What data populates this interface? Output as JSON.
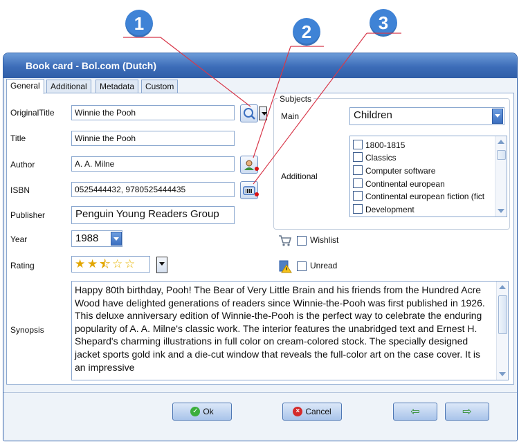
{
  "callouts": [
    "1",
    "2",
    "3"
  ],
  "window": {
    "title": "Book card - Bol.com (Dutch)"
  },
  "tabs": [
    "General",
    "Additional",
    "Metadata",
    "Custom fields"
  ],
  "fields": {
    "original_title": {
      "label": "OriginalTitle",
      "value": "Winnie the Pooh"
    },
    "title": {
      "label": "Title",
      "value": "Winnie the Pooh"
    },
    "author": {
      "label": "Author",
      "value": "A. A. Milne"
    },
    "isbn": {
      "label": "ISBN",
      "value": "0525444432, 9780525444435"
    },
    "publisher": {
      "label": "Publisher",
      "value": "Penguin Young Readers Group"
    },
    "year": {
      "label": "Year",
      "value": "1988"
    },
    "rating": {
      "label": "Rating",
      "value": 2.5,
      "max": 5
    },
    "synopsis": {
      "label": "Synopsis",
      "value": "Happy 80th birthday, Pooh! The Bear of Very Little Brain and his friends from the Hundred Acre Wood have delighted generations of readers since Winnie-the-Pooh was first published in 1926. This deluxe anniversary edition of Winnie-the-Pooh is the perfect way to celebrate the enduring popularity of A. A. Milne's classic work. The interior features the unabridged text and Ernest H. Shepard's charming illustrations in full color on cream-colored stock. The specially designed jacket sports gold ink and a die-cut window that reveals the full-color art on the case cover. It is an impressive"
    }
  },
  "subjects": {
    "group_title": "Subjects",
    "main_label": "Main",
    "main_value": "Children",
    "additional_label": "Additional",
    "items": [
      "1800-1815",
      "Classics",
      "Computer software",
      "Continental european",
      "Continental european fiction (fict",
      "Development"
    ]
  },
  "checks": {
    "wishlist": "Wishlist",
    "unread": "Unread"
  },
  "buttons": {
    "ok": "Ok",
    "cancel": "Cancel"
  },
  "colors": {
    "accent": "#3f83d6",
    "titlebar": "#3c6cb8",
    "callout_line": "#d8384a"
  },
  "icons": {
    "original_title_search": "search-web-icon",
    "author_lookup": "user-search-icon",
    "isbn_scan": "barcode-scanner-icon",
    "wishlist": "cart-icon",
    "unread": "warning-book-icon"
  }
}
